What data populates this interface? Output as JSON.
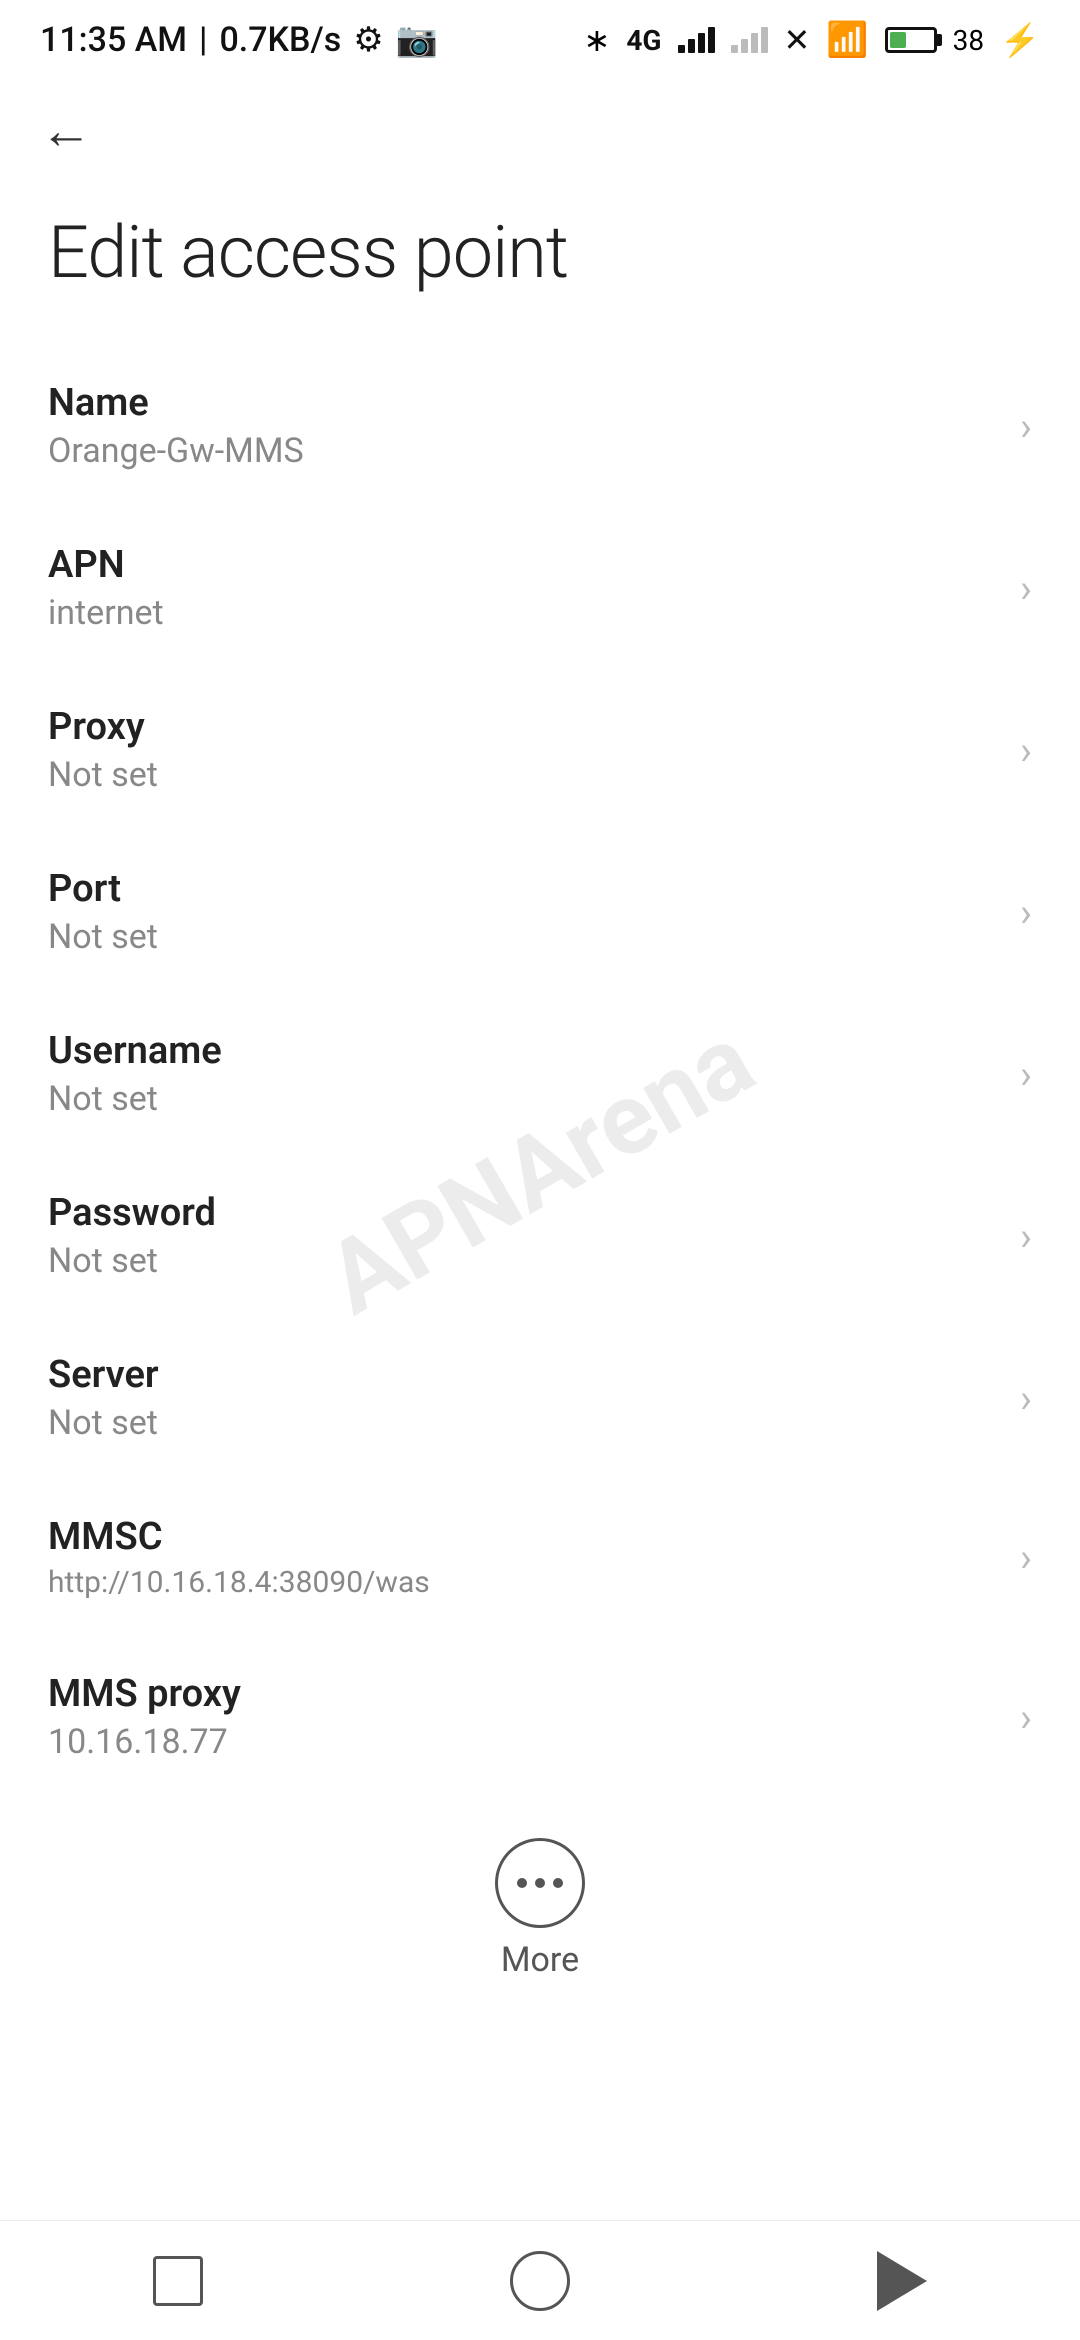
{
  "statusBar": {
    "time": "11:35 AM",
    "speed": "0.7KB/s",
    "battery": "38"
  },
  "nav": {
    "backLabel": "←"
  },
  "page": {
    "title": "Edit access point"
  },
  "settings": [
    {
      "label": "Name",
      "value": "Orange-Gw-MMS"
    },
    {
      "label": "APN",
      "value": "internet"
    },
    {
      "label": "Proxy",
      "value": "Not set"
    },
    {
      "label": "Port",
      "value": "Not set"
    },
    {
      "label": "Username",
      "value": "Not set"
    },
    {
      "label": "Password",
      "value": "Not set"
    },
    {
      "label": "Server",
      "value": "Not set"
    },
    {
      "label": "MMSC",
      "value": "http://10.16.18.4:38090/was"
    },
    {
      "label": "MMS proxy",
      "value": "10.16.18.77"
    }
  ],
  "more": {
    "label": "More"
  },
  "watermark": {
    "text": "APNArena"
  }
}
